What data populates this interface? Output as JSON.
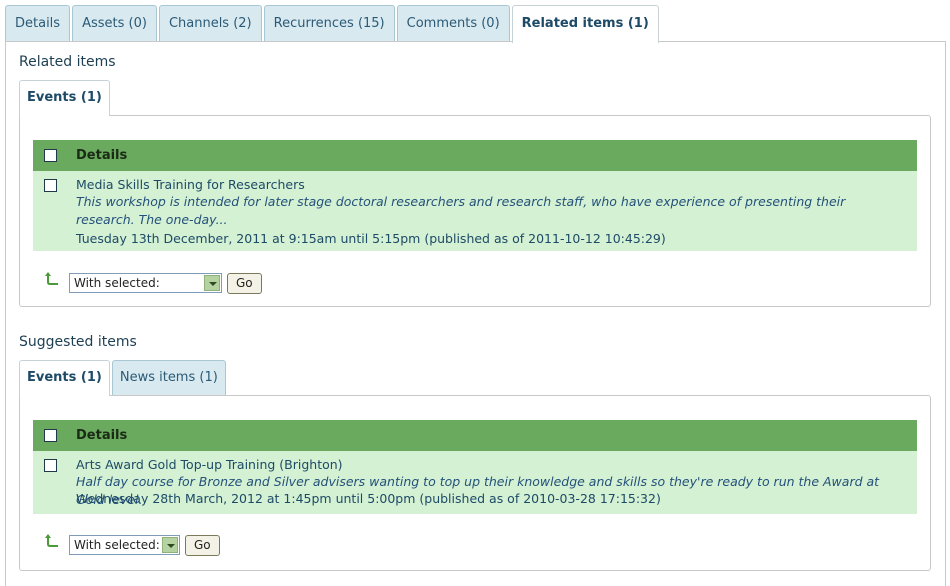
{
  "top_tabs": [
    {
      "label": "Details"
    },
    {
      "label": "Assets (0)"
    },
    {
      "label": "Channels (2)"
    },
    {
      "label": "Recurrences (15)"
    },
    {
      "label": "Comments (0)"
    },
    {
      "label": "Related items (1)"
    }
  ],
  "related": {
    "title": "Related items",
    "tabs": [
      {
        "label": "Events (1)"
      }
    ],
    "header": "Details",
    "rows": [
      {
        "title": "Media Skills Training for Researchers",
        "description": "This workshop is intended for later stage doctoral researchers and research staff, who have experience of presenting their research. The one-day...",
        "date": "Tuesday 13th December, 2011 at 9:15am until 5:15pm (published as of 2011-10-12 10:45:29)"
      }
    ],
    "select_value": "With selected:",
    "go_label": "Go"
  },
  "suggested": {
    "title": "Suggested items",
    "tabs": [
      {
        "label": "Events (1)"
      },
      {
        "label": "News items (1)"
      }
    ],
    "header": "Details",
    "rows": [
      {
        "title": "Arts Award Gold Top-up Training (Brighton)",
        "description": "Half day course for Bronze and Silver advisers wanting to top up their knowledge and skills so they're ready to run the Award at Gold level.",
        "date": "Wednesday 28th March, 2012 at 1:45pm until 5:00pm (published as of 2010-03-28 17:15:32)"
      }
    ],
    "select_value": "With selected:",
    "go_label": "Go"
  },
  "colors": {
    "header_green": "#6aaa5f",
    "row_green": "#d4f1d4",
    "tab_blue": "#d8e9f0",
    "link": "#1d4a66"
  }
}
